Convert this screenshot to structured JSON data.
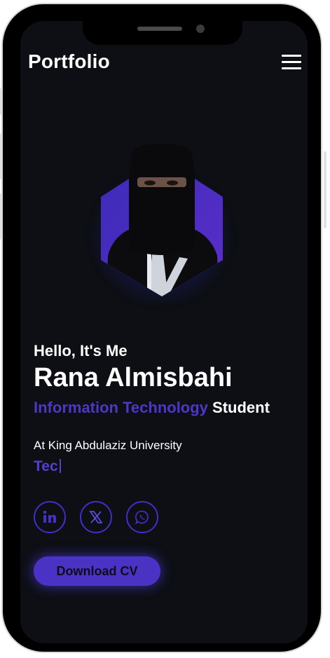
{
  "header": {
    "brand": "Portfolio",
    "menu_icon": "hamburger-menu-icon"
  },
  "hero": {
    "greeting": "Hello, It's Me",
    "name": "Rana Almisbahi",
    "role_accent": "Information Technology",
    "role_rest": "Student",
    "university": "At King Abdulaziz University",
    "typed_text": "Tec"
  },
  "social": [
    {
      "icon": "linkedin-icon"
    },
    {
      "icon": "x-twitter-icon"
    },
    {
      "icon": "whatsapp-icon"
    }
  ],
  "actions": {
    "download_cv": "Download CV"
  },
  "colors": {
    "background": "#0d0f14",
    "accent": "#4c37c9",
    "button": "#4a33c4",
    "text": "#ffffff"
  }
}
